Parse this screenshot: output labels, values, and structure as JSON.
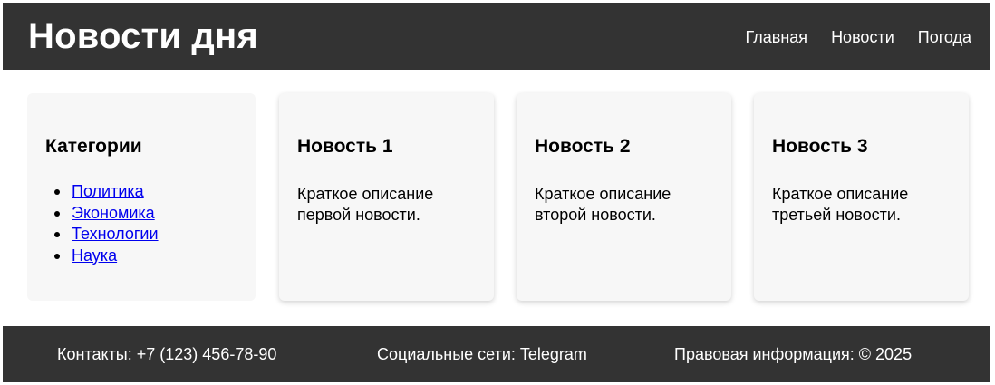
{
  "header": {
    "title": "Новости дня",
    "nav": [
      "Главная",
      "Новости",
      "Погода"
    ]
  },
  "sidebar": {
    "title": "Категории",
    "items": [
      "Политика",
      "Экономика",
      "Технологии",
      "Наука"
    ]
  },
  "news": [
    {
      "title": "Новость 1",
      "text": "Краткое описание первой новости."
    },
    {
      "title": "Новость 2",
      "text": "Краткое описание второй новости."
    },
    {
      "title": "Новость 3",
      "text": "Краткое описание третьей новости."
    }
  ],
  "footer": {
    "contacts": "Контакты: +7 (123) 456-78-90",
    "social_label": "Социальные сети: ",
    "social_link": "Telegram",
    "legal": "Правовая информация: © 2025"
  },
  "colors": {
    "header_bg": "#333333",
    "card_bg": "#f7f7f7",
    "link": "#0000ee"
  }
}
